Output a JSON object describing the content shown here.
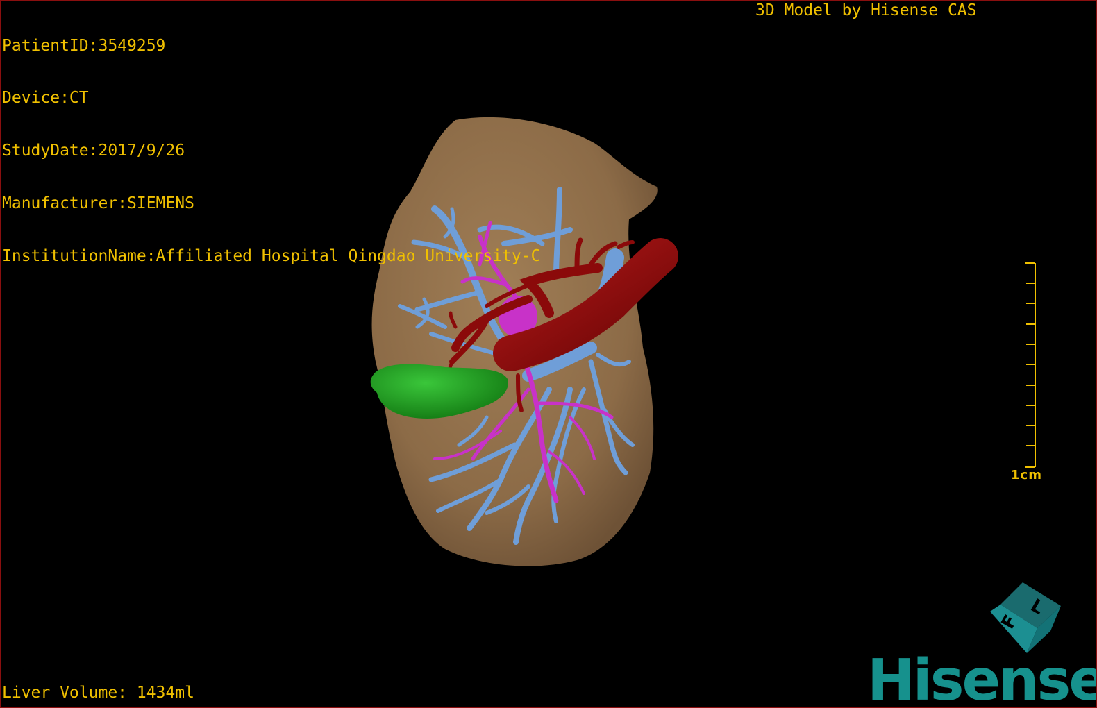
{
  "patient": {
    "patient_id": "PatientID:3549259",
    "device": "Device:CT",
    "study_date": "StudyDate:2017/9/26",
    "manufacturer": "Manufacturer:SIEMENS",
    "institution": "InstitutionName:Affiliated Hospital Qingdao University-C"
  },
  "credit": "3D Model by Hisense CAS",
  "liver_volume": "Liver Volume: 1434ml",
  "scale_bar": {
    "label": "1cm"
  },
  "brand": {
    "name": "Hisense"
  },
  "orientation_cube": {
    "face_letters": [
      "F",
      "L"
    ]
  },
  "colors": {
    "text": "#f0c000",
    "liver": "#8c6b47",
    "portal_vein": "#6f9ed8",
    "hepatic_artery": "#8b0a0a",
    "bile_duct": "#c832c8",
    "gallbladder": "#1fa51f",
    "brand": "#16918d"
  }
}
